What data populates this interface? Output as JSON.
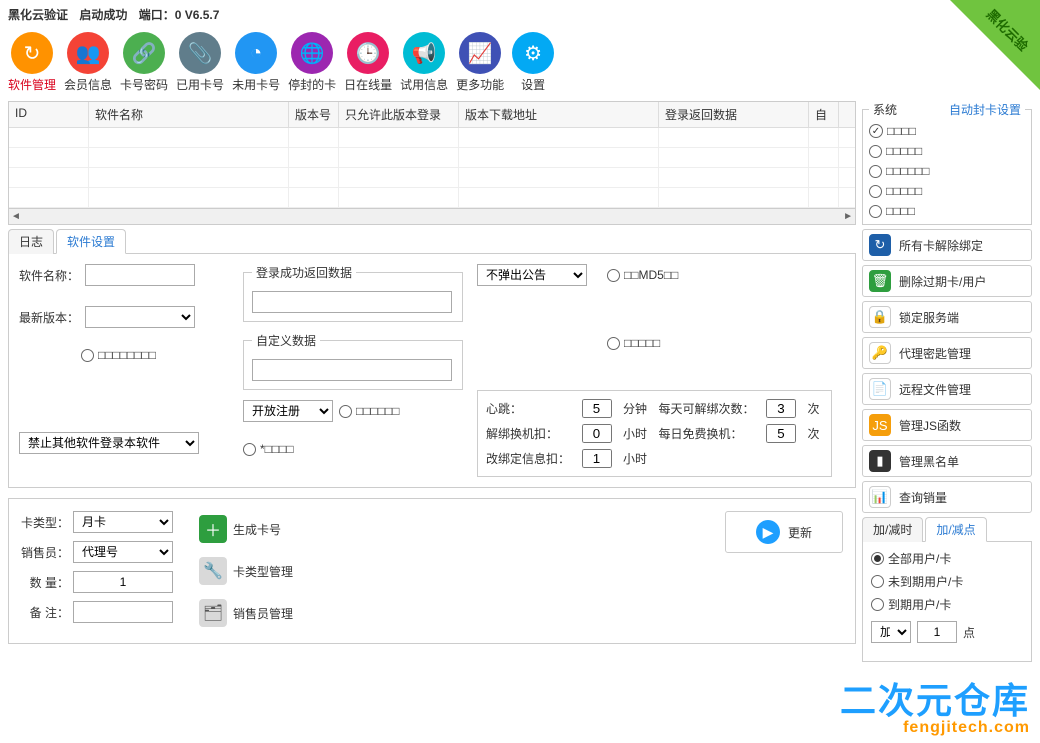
{
  "title": {
    "app": "黑化云验证",
    "status": "启动成功",
    "port": "端口：0 V6.5.7"
  },
  "corner": "黑化云验",
  "toolbar": [
    {
      "label": "软件管理",
      "color": "#ff9200",
      "glyph": "↻",
      "active": true
    },
    {
      "label": "会员信息",
      "color": "#f44336",
      "glyph": "👥"
    },
    {
      "label": "卡号密码",
      "color": "#4caf50",
      "glyph": "🔗"
    },
    {
      "label": "已用卡号",
      "color": "#607d8b",
      "glyph": "📎"
    },
    {
      "label": "未用卡号",
      "color": "#2196f3",
      "glyph": "◔"
    },
    {
      "label": "停封的卡",
      "color": "#9c27b0",
      "glyph": "🌐"
    },
    {
      "label": "日在线量",
      "color": "#e91e63",
      "glyph": "🕒"
    },
    {
      "label": "试用信息",
      "color": "#00bcd4",
      "glyph": "📢"
    },
    {
      "label": "更多功能",
      "color": "#3f51b5",
      "glyph": "📈"
    },
    {
      "label": "设置",
      "color": "#03a9f4",
      "glyph": "⚙"
    }
  ],
  "grid_headers": [
    "ID",
    "软件名称",
    "版本号",
    "只允许此版本登录",
    "版本下载地址",
    "登录返回数据",
    "自"
  ],
  "grid_widths": [
    80,
    200,
    50,
    120,
    200,
    150,
    30
  ],
  "tabs_main": {
    "log": "日志",
    "settings": "软件设置"
  },
  "soft_settings": {
    "name_label": "软件名称：",
    "version_label": "最新版本：",
    "force_version": "□□□□□□□□",
    "login_data_label": "登录成功返回数据",
    "custom_data_label": "自定义数据",
    "open_reg": "开放注册",
    "open_reg_opt": "□□□□□□",
    "star_opt": "*□□□□",
    "notice_select": "不弹出公告",
    "md5_opt": "□□MD5□□",
    "box_opt": "□□□□□",
    "block_other_label": "禁止其他软件登录本软件"
  },
  "heartbeat": {
    "hb_label": "心跳：",
    "hb_val": "5",
    "hb_unit": "分钟",
    "unbind_count_label": "每天可解绑次数：",
    "unbind_count_val": "3",
    "unbind_count_unit": "次",
    "unbind_fee_label": "解绑换机扣：",
    "unbind_fee_val": "0",
    "unbind_fee_unit": "小时",
    "free_change_label": "每日免费换机：",
    "free_change_val": "5",
    "free_change_unit": "次",
    "rebind_fee_label": "改绑定信息扣：",
    "rebind_fee_val": "1",
    "rebind_fee_unit": "小时"
  },
  "gen": {
    "type_label": "卡类型：",
    "type_val": "月卡",
    "seller_label": "销售员：",
    "seller_val": "代理号",
    "qty_label": "数  量：",
    "qty_val": "1",
    "remark_label": "备  注：",
    "btn_gen": "生成卡号",
    "btn_type": "卡类型管理",
    "btn_seller": "销售员管理"
  },
  "update_btn": "更新",
  "right_group": {
    "title_left": "系统",
    "title_right": "自动封卡设置",
    "opts": [
      "□□□□",
      "□□□□□",
      "□□□□□□",
      "□□□□□",
      "□□□□"
    ]
  },
  "actions": [
    {
      "label": "所有卡解除绑定",
      "bg": "#1e5fa8",
      "glyph": "↻"
    },
    {
      "label": "删除过期卡/用户",
      "bg": "#2e9e3f",
      "glyph": "🗑"
    },
    {
      "label": "锁定服务端",
      "bg": "#ffffff",
      "glyph": "🔒",
      "fg": "#d9001b"
    },
    {
      "label": "代理密匙管理",
      "bg": "#ffffff",
      "glyph": "🔑",
      "fg": "#e6b800"
    },
    {
      "label": "远程文件管理",
      "bg": "#ffffff",
      "glyph": "📄",
      "fg": "#f59e0b"
    },
    {
      "label": "管理JS函数",
      "bg": "#f59e0b",
      "glyph": "JS"
    },
    {
      "label": "管理黑名单",
      "bg": "#333333",
      "glyph": "▮"
    },
    {
      "label": "查询销量",
      "bg": "#ffffff",
      "glyph": "📊",
      "fg": "#f59e0b"
    }
  ],
  "right_tabs": {
    "time": "加/减时",
    "points": "加/减点"
  },
  "point_opts": [
    "全部用户/卡",
    "未到期用户/卡",
    "到期用户/卡"
  ],
  "point_op_sel": "加",
  "point_op_val": "1",
  "point_op_unit": "点",
  "watermark": {
    "cn": "二次元仓库",
    "en": "fengjitech.com"
  }
}
